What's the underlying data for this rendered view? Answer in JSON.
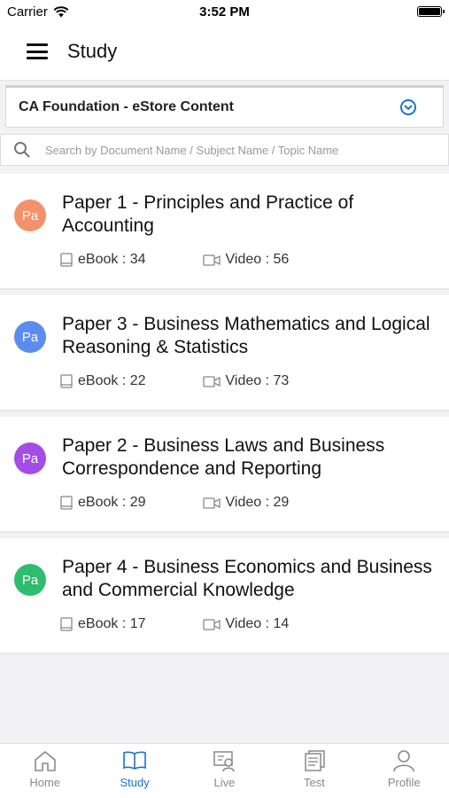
{
  "status_bar": {
    "carrier": "Carrier",
    "time": "3:52 PM"
  },
  "header": {
    "title": "Study"
  },
  "course_selector": {
    "label": "CA Foundation - eStore Content"
  },
  "search": {
    "placeholder": "Search by Document Name / Subject Name / Topic Name",
    "value": ""
  },
  "papers": [
    {
      "avatar": "Pa",
      "avatar_color": "#f5916a",
      "title": "Paper 1 - Principles and Practice of Accounting",
      "ebook": "eBook : 34",
      "video": "Video : 56"
    },
    {
      "avatar": "Pa",
      "avatar_color": "#5b8def",
      "title": "Paper 3 - Business Mathematics and Logical Reasoning & Statistics",
      "ebook": "eBook : 22",
      "video": "Video : 73"
    },
    {
      "avatar": "Pa",
      "avatar_color": "#a24ee6",
      "title": "Paper 2 - Business Laws and Business Correspondence and Reporting",
      "ebook": "eBook : 29",
      "video": "Video : 29"
    },
    {
      "avatar": "Pa",
      "avatar_color": "#2ebd6e",
      "title": "Paper 4 - Business Economics and Business and Commercial Knowledge",
      "ebook": "eBook : 17",
      "video": "Video : 14"
    }
  ],
  "tabs": [
    {
      "label": "Home",
      "icon": "home-icon",
      "active": false
    },
    {
      "label": "Study",
      "icon": "book-icon",
      "active": true
    },
    {
      "label": "Live",
      "icon": "live-icon",
      "active": false
    },
    {
      "label": "Test",
      "icon": "test-icon",
      "active": false
    },
    {
      "label": "Profile",
      "icon": "profile-icon",
      "active": false
    }
  ],
  "colors": {
    "accent": "#1a73c4",
    "inactive_tab": "#888888"
  }
}
